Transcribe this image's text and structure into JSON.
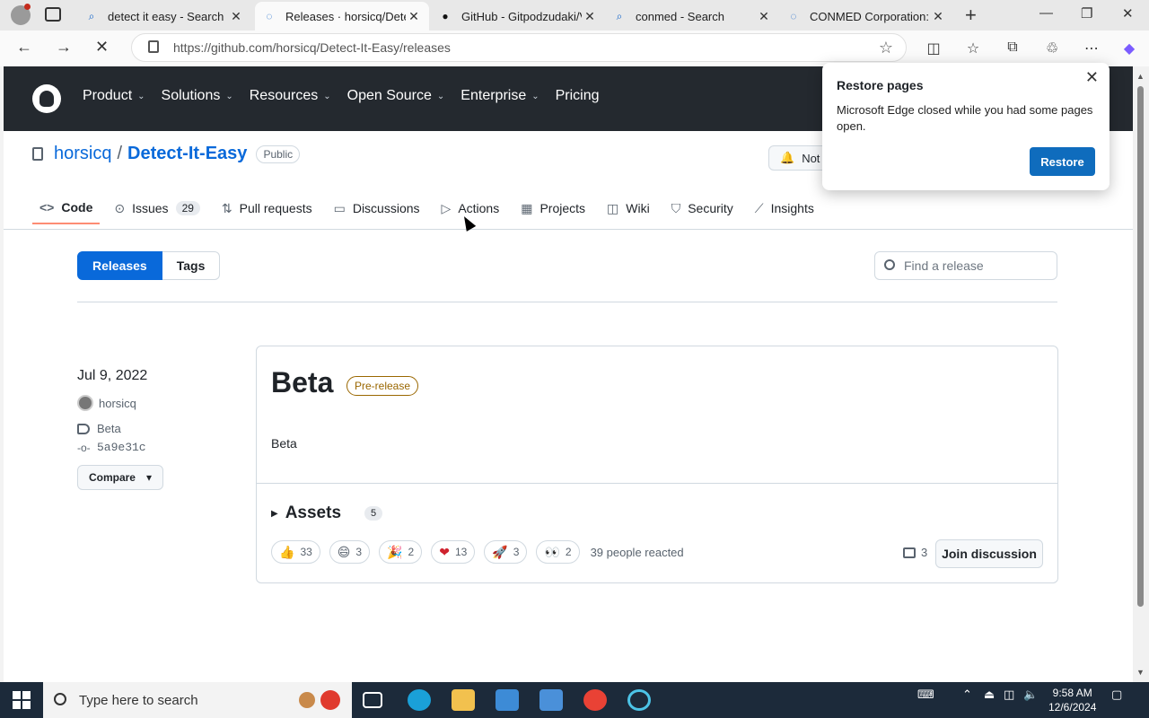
{
  "browser": {
    "tabs": [
      {
        "title": "detect it easy - Search",
        "favicon": "search-icon"
      },
      {
        "title": "Releases · horsicq/Detect-It-Easy",
        "favicon": "loading-icon",
        "active": true
      },
      {
        "title": "GitHub - Gitpodzudaki/V",
        "favicon": "github-icon"
      },
      {
        "title": "conmed - Search",
        "favicon": "search-icon"
      },
      {
        "title": "CONMED Corporation: Sur",
        "favicon": "loading-icon"
      }
    ],
    "url": "https://github.com/horsicq/Detect-It-Easy/releases"
  },
  "github": {
    "nav": [
      "Product",
      "Solutions",
      "Resources",
      "Open Source",
      "Enterprise",
      "Pricing"
    ],
    "owner": "horsicq",
    "repo": "Detect-It-Easy",
    "visibility": "Public",
    "notifications_label": "Not",
    "repo_tabs": [
      {
        "label": "Code",
        "icon": "code-icon"
      },
      {
        "label": "Issues",
        "count": "29",
        "icon": "issue-icon"
      },
      {
        "label": "Pull requests",
        "icon": "pull-request-icon"
      },
      {
        "label": "Discussions",
        "icon": "discussion-icon"
      },
      {
        "label": "Actions",
        "icon": "play-icon"
      },
      {
        "label": "Projects",
        "icon": "table-icon"
      },
      {
        "label": "Wiki",
        "icon": "book-icon"
      },
      {
        "label": "Security",
        "icon": "shield-icon"
      },
      {
        "label": "Insights",
        "icon": "graph-icon"
      }
    ],
    "segment": {
      "releases": "Releases",
      "tags": "Tags"
    },
    "find_placeholder": "Find a release"
  },
  "release": {
    "date": "Jul 9, 2022",
    "author": "horsicq",
    "tag": "Beta",
    "commit": "5a9e31c",
    "compare_label": "Compare",
    "title": "Beta",
    "badge": "Pre-release",
    "body": "Beta",
    "assets_label": "Assets",
    "assets_count": "5",
    "reactions": [
      {
        "emoji": "👍",
        "count": "33"
      },
      {
        "emoji": "😄",
        "count": "3"
      },
      {
        "emoji": "🎉",
        "count": "2"
      },
      {
        "emoji": "❤",
        "count": "13"
      },
      {
        "emoji": "🚀",
        "count": "3"
      },
      {
        "emoji": "👀",
        "count": "2"
      }
    ],
    "reacted_text": "39 people reacted",
    "comments": "3",
    "join_label": "Join discussion"
  },
  "popup": {
    "title": "Restore pages",
    "message": "Microsoft Edge closed while you had some pages open.",
    "button": "Restore"
  },
  "taskbar": {
    "search_placeholder": "Type here to search",
    "time": "9:58 AM",
    "date": "12/6/2024"
  },
  "colors": {
    "accent": "#0969da",
    "header": "#24292f",
    "restore": "#0f6cbd"
  }
}
